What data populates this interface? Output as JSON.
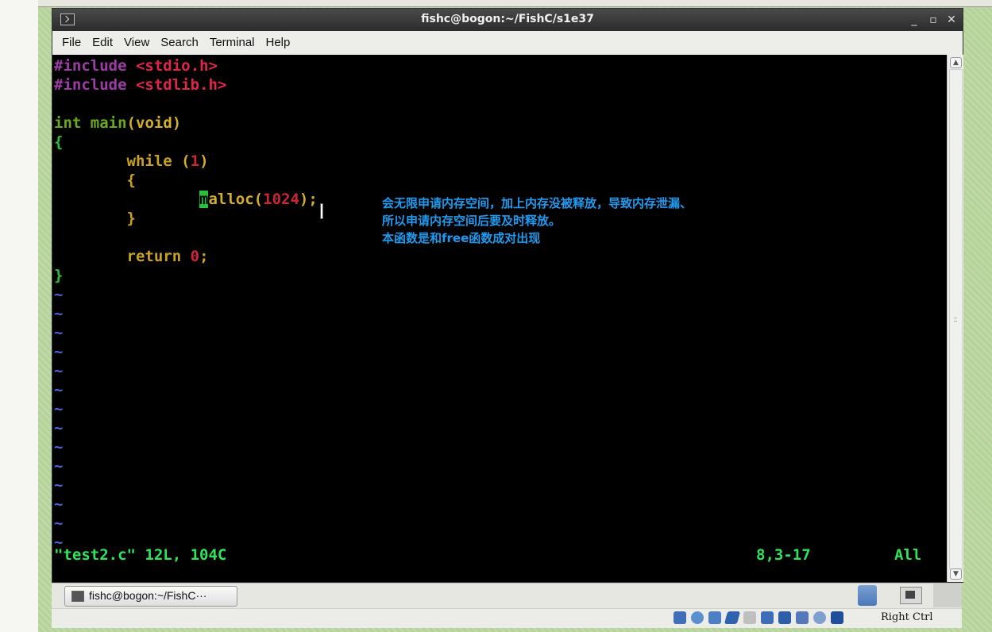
{
  "window": {
    "title": "fishc@bogon:~/FishC/s1e37"
  },
  "menu": [
    "File",
    "Edit",
    "View",
    "Search",
    "Terminal",
    "Help"
  ],
  "code": {
    "l1_pre": "#include",
    "l1_header": "<stdio.h>",
    "l2_pre": "#include",
    "l2_header": "<stdlib.h>",
    "l4_type": "int",
    "l4_func": "main",
    "l4_paren_open": "(",
    "l4_param": "void",
    "l4_paren_close": ")",
    "l5_brace": "{",
    "l6_kw": "while",
    "l6_paren_open": "(",
    "l6_num": "1",
    "l6_paren_close": ")",
    "l7_brace": "{",
    "l8_cursor_char": "m",
    "l8_func": "alloc(",
    "l8_num": "1024",
    "l8_tail": ");",
    "l9_brace": "}",
    "l11_kw": "return",
    "l11_num": "0",
    "l11_semi": ";",
    "l12_brace": "}"
  },
  "tilde_char": "~",
  "status": {
    "file_info": "\"test2.c\" 12L, 104C",
    "position": "8,3-17",
    "scroll": "All"
  },
  "annotation": {
    "line1": "会无限申请内存空间，加上内存没被释放，导致内存泄漏、",
    "line2": "所以申请内存空间后要及时释放。",
    "line3": "本函数是和free函数成对出现"
  },
  "taskbar": {
    "task_label": "fishc@bogon:~/FishC···"
  },
  "vbox": {
    "host_key": "Right Ctrl"
  },
  "window_buttons": {
    "minimize": "_",
    "maximize": "▫",
    "close": "✕"
  },
  "scrollbar": {
    "up": "▲",
    "down": "▼"
  },
  "icons": [
    "terminal-icon",
    "optical-disk-icon",
    "usb-icon",
    "shared-folder-icon",
    "display-icon",
    "network-icon",
    "recording-icon",
    "cpu-icon",
    "mouse-integration-icon",
    "host-key-arrow-icon"
  ]
}
